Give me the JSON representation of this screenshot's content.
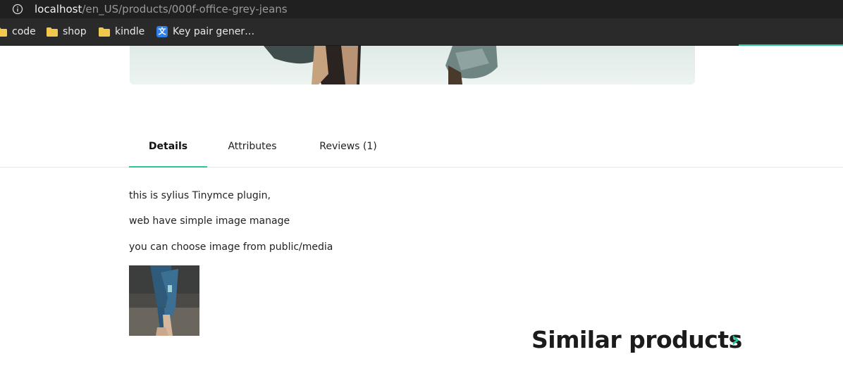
{
  "browser": {
    "url_host": "localhost",
    "url_path": "/en_US/products/000f-office-grey-jeans",
    "bookmarks": [
      {
        "label": "code",
        "icon": "folder-icon"
      },
      {
        "label": "shop",
        "icon": "folder-icon"
      },
      {
        "label": "kindle",
        "icon": "folder-icon"
      },
      {
        "label": "Key pair gener…",
        "icon": "translate-icon"
      }
    ]
  },
  "tabs": [
    {
      "label": "Details",
      "active": true
    },
    {
      "label": "Attributes",
      "active": false
    },
    {
      "label": "Reviews (1)",
      "active": false
    }
  ],
  "details": {
    "lines": [
      "this is sylius Tinymce plugin,",
      "web have simple image manage",
      "you can choose image from public/media"
    ]
  },
  "similar": {
    "title": "Similar products",
    "arrow": "›"
  },
  "colors": {
    "accent": "#2bc49a",
    "chrome_dark": "#202020",
    "text": "#222222"
  }
}
